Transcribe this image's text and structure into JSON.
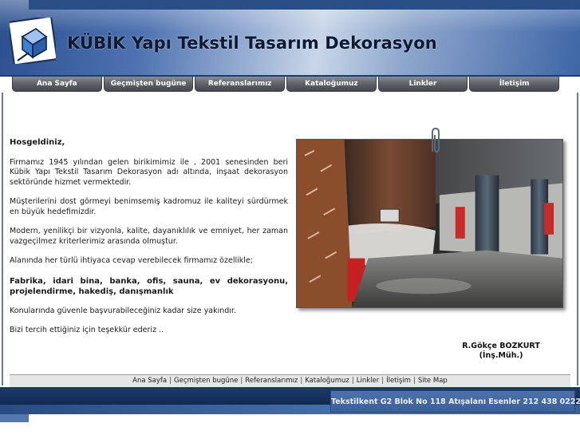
{
  "header": {
    "title": "KÜBİK Yapı Tekstil Tasarım Dekorasyon"
  },
  "nav": {
    "items": [
      {
        "label": "Ana Sayfa"
      },
      {
        "label": "Geçmişten bugüne"
      },
      {
        "label": "Referanslarımız"
      },
      {
        "label": "Kataloğumuz"
      },
      {
        "label": "Linkler"
      },
      {
        "label": "İletişim"
      }
    ]
  },
  "content": {
    "greeting": "Hosgeldiniz,",
    "paragraphs": [
      "Firmamız 1945 yılından gelen birikimimiz ile , 2001 senesinden beri Kübik Yapı Tekstil Tasarım Dekorasyon adı altında, inşaat dekorasyon sektöründe hizmet vermektedir.",
      "Müşterilerini dost görmeyi benimsemiş kadromuz ile kaliteyi sürdürmek en büyük hedefimizdir.",
      "Modern, yenilikçi bir vizyonla, kalite, dayanıklılık ve emniyet, her zaman vazgeçilmez kriterlerimiz arasında olmuştur.",
      "Alanında her türlü ihtiyaca cevap verebilecek firmamız özellikle;"
    ],
    "services": "Fabrika, idari bina, banka, ofis, sauna, ev dekorasyonu, projelendirme, hakediş, danışmanlık",
    "closing": [
      "Konularında güvenle başvurabileceğiniz kadar size yakındır.",
      "Bizi tercih ettiğiniz için teşekkür ederiz .."
    ],
    "signature_name": "R.Gökçe BOZKURT",
    "signature_title": "(İnş.Müh.)"
  },
  "footer": {
    "links": [
      {
        "label": "Ana Sayfa"
      },
      {
        "label": "Geçmişten bugüne"
      },
      {
        "label": "Referanslarımız"
      },
      {
        "label": "Kataloğumuz"
      },
      {
        "label": "Linkler"
      },
      {
        "label": "İletişim"
      },
      {
        "label": "Site Map"
      }
    ],
    "address": "Tekstilkent G2 Blok No 118 Atışalanı Esenler 212 438 0222"
  },
  "colors": {
    "header_blue": "#2b4f8f",
    "nav_gray": "#5e6268",
    "footer_navy": "#1d3a6b"
  },
  "icons": {
    "logo": "cube-logo-icon",
    "clip": "paper-clip-icon"
  }
}
